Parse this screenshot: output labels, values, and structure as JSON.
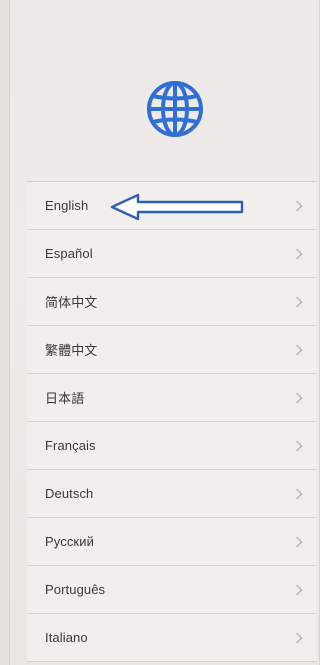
{
  "languages": [
    {
      "label": "English"
    },
    {
      "label": "Español"
    },
    {
      "label": "简体中文"
    },
    {
      "label": "繁體中文"
    },
    {
      "label": "日本語"
    },
    {
      "label": "Français"
    },
    {
      "label": "Deutsch"
    },
    {
      "label": "Русский"
    },
    {
      "label": "Português"
    },
    {
      "label": "Italiano"
    }
  ],
  "icons": {
    "header": "globe-icon",
    "row_disclosure": "chevron-right-icon",
    "annotation": "left-arrow-icon"
  },
  "colors": {
    "globe": "#2f6fd6",
    "annotation_arrow": "#2e5fb8",
    "text": "#3a3a3a",
    "chevron": "#b8b3ae"
  }
}
